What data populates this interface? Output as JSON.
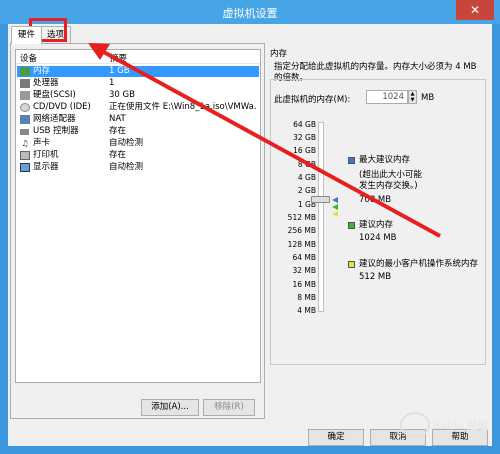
{
  "window": {
    "title": "虚拟机设置",
    "close_glyph": "✕"
  },
  "tabs": [
    {
      "label": "硬件",
      "active": true
    },
    {
      "label": "选项",
      "active": false
    }
  ],
  "hardware_list": {
    "col_device": "设备",
    "col_summary": "摘要",
    "rows": [
      {
        "device": "内存",
        "summary": "1 GB",
        "icon": "memory-icon",
        "selected": true
      },
      {
        "device": "处理器",
        "summary": "1",
        "icon": "cpu-icon"
      },
      {
        "device": "硬盘(SCSI)",
        "summary": "30 GB",
        "icon": "hard-disk-icon"
      },
      {
        "device": "CD/DVD (IDE)",
        "summary": "正在使用文件 E:\\Win8_1a.iso\\VMWa...",
        "icon": "cd-dvd-icon"
      },
      {
        "device": "网络适配器",
        "summary": "NAT",
        "icon": "network-adapter-icon"
      },
      {
        "device": "USB 控制器",
        "summary": "存在",
        "icon": "usb-icon"
      },
      {
        "device": "声卡",
        "summary": "自动检测",
        "icon": "sound-card-icon"
      },
      {
        "device": "打印机",
        "summary": "存在",
        "icon": "printer-icon"
      },
      {
        "device": "显示器",
        "summary": "自动检测",
        "icon": "display-icon"
      }
    ]
  },
  "list_buttons": {
    "add": "添加(A)...",
    "remove": "移除(R)"
  },
  "memory_panel": {
    "group_title": "内存",
    "description": "指定分配给此虚拟机的内存量。内存大小必须为 4 MB 的倍数。",
    "field_label": "此虚拟机的内存(M):",
    "field_value": "1024",
    "unit": "MB",
    "scale": [
      "64 GB",
      "32 GB",
      "16 GB",
      "8 GB",
      "4 GB",
      "2 GB",
      "1 GB",
      "512 MB",
      "256 MB",
      "128 MB",
      "64 MB",
      "32 MB",
      "16 MB",
      "8 MB",
      "4 MB"
    ],
    "legend": {
      "max_recommended": {
        "title": "最大建议内存",
        "note_1": "(超出此大小可能",
        "note_2": "发生内存交换。)",
        "value": "708 MB",
        "color": "#3c78c8"
      },
      "recommended": {
        "title": "建议内存",
        "value": "1024 MB",
        "color": "#3cb43c"
      },
      "guest_min": {
        "title": "建议的最小客户机操作系统内存",
        "value": "512 MB",
        "color": "#e8e040"
      }
    }
  },
  "dialog_buttons": {
    "ok": "确定",
    "cancel": "取消",
    "help": "帮助"
  },
  "annotation_color": "#e81f1f",
  "watermark": "Baidu 经验"
}
